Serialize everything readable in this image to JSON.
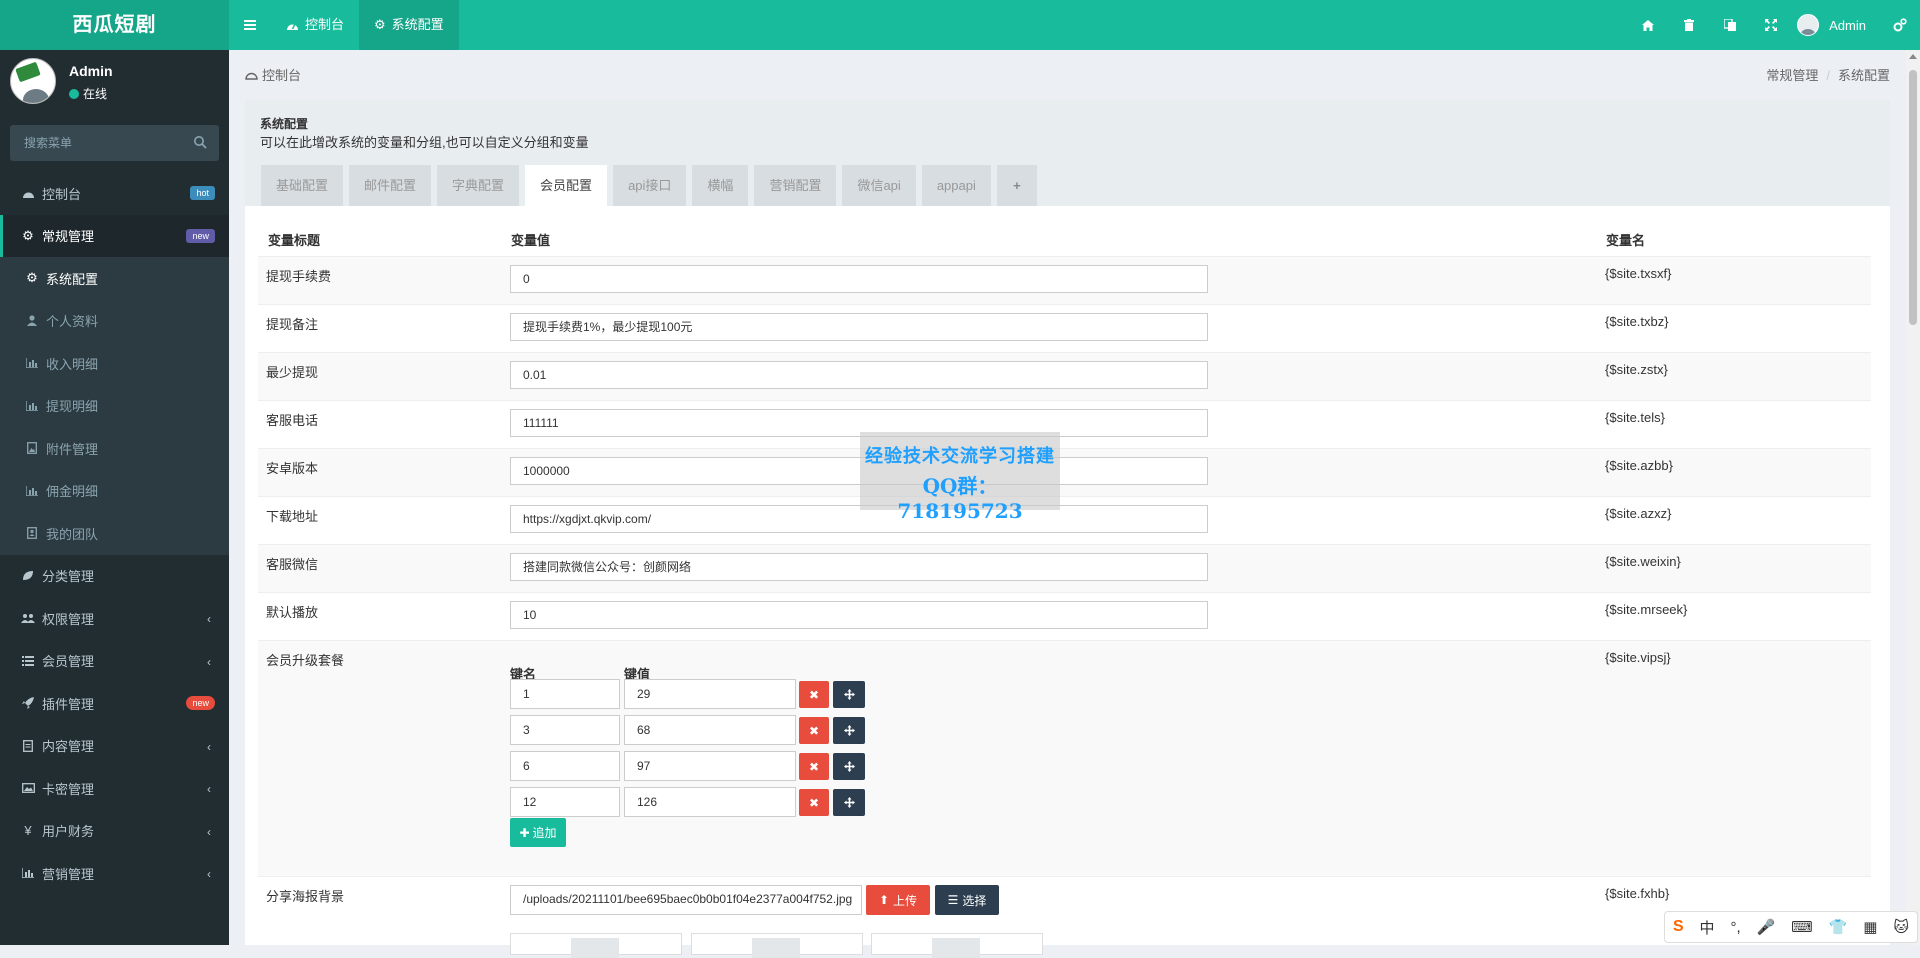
{
  "app": {
    "title": "西瓜短剧"
  },
  "topbar": {
    "tabs": [
      {
        "label": "控制台",
        "icon": "dashboard-icon"
      },
      {
        "label": "系统配置",
        "icon": "gear-icon"
      }
    ],
    "user": "Admin"
  },
  "sidebar": {
    "user_name": "Admin",
    "status": "在线",
    "search_placeholder": "搜索菜单",
    "items": [
      {
        "label": "控制台",
        "icon": "dashboard-icon",
        "badge": "hot"
      },
      {
        "label": "常规管理",
        "icon": "cogs-icon",
        "badge": "new"
      },
      {
        "label": "系统配置",
        "icon": "gear-icon"
      },
      {
        "label": "个人资料",
        "icon": "user-icon"
      },
      {
        "label": "收入明细",
        "icon": "bar-chart-icon"
      },
      {
        "label": "提现明细",
        "icon": "bar-chart-icon"
      },
      {
        "label": "附件管理",
        "icon": "file-image-icon"
      },
      {
        "label": "佣金明细",
        "icon": "bar-chart-icon"
      },
      {
        "label": "我的团队",
        "icon": "address-book-icon"
      },
      {
        "label": "分类管理",
        "icon": "leaf-icon"
      },
      {
        "label": "权限管理",
        "icon": "group-icon"
      },
      {
        "label": "会员管理",
        "icon": "list-icon"
      },
      {
        "label": "插件管理",
        "icon": "rocket-icon",
        "badge": "new"
      },
      {
        "label": "内容管理",
        "icon": "file-text-icon"
      },
      {
        "label": "卡密管理",
        "icon": "picture-icon"
      },
      {
        "label": "用户财务",
        "icon": "yen-icon"
      },
      {
        "label": "营销管理",
        "icon": "bar-chart-icon"
      }
    ]
  },
  "breadcrumb": {
    "home": "控制台",
    "path": [
      "常规管理",
      "系统配置"
    ]
  },
  "panel": {
    "title": "系统配置",
    "subtitle": "可以在此增改系统的变量和分组,也可以自定义分组和变量",
    "tabs": [
      "基础配置",
      "邮件配置",
      "字典配置",
      "会员配置",
      "api接口",
      "横幅",
      "营销配置",
      "微信api",
      "appapi",
      "+"
    ],
    "active_tab": "会员配置"
  },
  "table": {
    "headers": [
      "变量标题",
      "变量值",
      "变量名"
    ],
    "rows": [
      {
        "title": "提现手续费",
        "value": "0",
        "name": "{$site.txsxf}"
      },
      {
        "title": "提现备注",
        "value": "提现手续费1%，最少提现100元",
        "name": "{$site.txbz}"
      },
      {
        "title": "最少提现",
        "value": "0.01",
        "name": "{$site.zstx}"
      },
      {
        "title": "客服电话",
        "value": "111111",
        "name": "{$site.tels}"
      },
      {
        "title": "安卓版本",
        "value": "1000000",
        "name": "{$site.azbb}"
      },
      {
        "title": "下载地址",
        "value": "https://xgdjxt.qkvip.com/",
        "name": "{$site.azxz}"
      },
      {
        "title": "客服微信",
        "value": "搭建同款微信公众号：创颜网络",
        "name": "{$site.weixin}"
      },
      {
        "title": "默认播放",
        "value": "10",
        "name": "{$site.mrseek}"
      }
    ],
    "vip": {
      "title": "会员升级套餐",
      "name": "{$site.vipsj}",
      "key_header": "键名",
      "val_header": "键值",
      "pairs": [
        {
          "key": "1",
          "value": "29"
        },
        {
          "key": "3",
          "value": "68"
        },
        {
          "key": "6",
          "value": "97"
        },
        {
          "key": "12",
          "value": "126"
        }
      ],
      "add_label": "追加"
    },
    "poster": {
      "title": "分享海报背景",
      "value": "/uploads/20211101/bee695baec0b0b01f04e2377a004f752.jpg",
      "name": "{$site.fxhb}",
      "upload_label": "上传",
      "choose_label": "选择"
    }
  },
  "watermark": {
    "line1": "经验技术交流学习搭建",
    "line2": "QQ群：718195723"
  },
  "ime": {
    "chars": [
      "中"
    ]
  },
  "colors": {
    "accent": "#18bc9c",
    "sidebar": "#222d32",
    "danger": "#e74c3c",
    "dark": "#2c3e50"
  }
}
